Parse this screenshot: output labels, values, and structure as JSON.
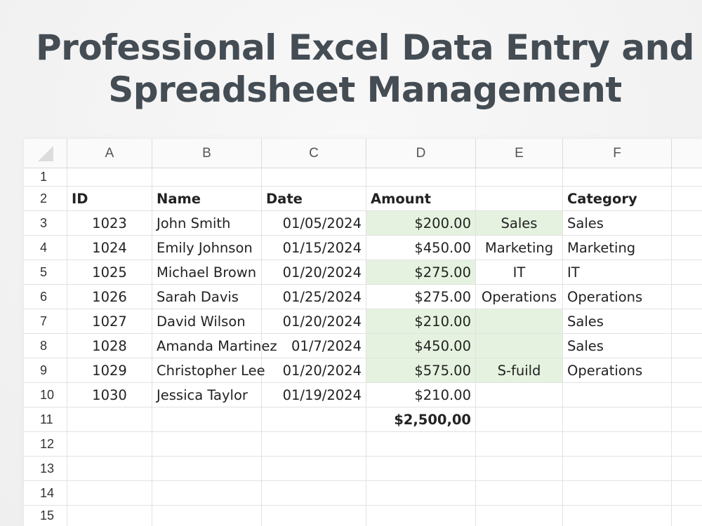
{
  "title_line1": "Professional Excel Data Entry and",
  "title_line2": "Spreadsheet Management",
  "columns": [
    "A",
    "B",
    "C",
    "D",
    "E",
    "F"
  ],
  "headers": {
    "id": "ID",
    "name": "Name",
    "date": "Date",
    "amount": "Amount",
    "e": "",
    "category": "Category"
  },
  "rows": [
    {
      "num": "3",
      "id": "1023",
      "name": "John Smith",
      "date": "01/05/2024",
      "amount": "$200.00",
      "e": "Sales",
      "category": "Sales"
    },
    {
      "num": "4",
      "id": "1024",
      "name": "Emily Johnson",
      "date": "01/15/2024",
      "amount": "$450.00",
      "e": "Marketing",
      "category": "Marketing"
    },
    {
      "num": "5",
      "id": "1025",
      "name": "Michael Brown",
      "date": "01/20/2024",
      "amount": "$275.00",
      "e": "IT",
      "category": "IT"
    },
    {
      "num": "6",
      "id": "1026",
      "name": "Sarah Davis",
      "date": "01/25/2024",
      "amount": "$275.00",
      "e": "Operations",
      "category": "Operations"
    },
    {
      "num": "7",
      "id": "1027",
      "name": "David Wilson",
      "date": "01/20/2024",
      "amount": "$210.00",
      "e": "",
      "category": "Sales"
    },
    {
      "num": "8",
      "id": "1028",
      "name": "Amanda Martinez",
      "date": "01/7/2024",
      "amount": "$450.00",
      "e": "",
      "category": "Sales"
    },
    {
      "num": "9",
      "id": "1029",
      "name": "Christopher Lee",
      "date": "01/20/2024",
      "amount": "$575.00",
      "e": "S-fuild",
      "category": "Operations"
    },
    {
      "num": "10",
      "id": "1030",
      "name": "Jessica Taylor",
      "date": "01/19/2024",
      "amount": "$210.00",
      "e": "",
      "category": ""
    }
  ],
  "total": "$2,500,00",
  "row_numbers": [
    "1",
    "2",
    "11",
    "12",
    "13",
    "14",
    "15"
  ]
}
